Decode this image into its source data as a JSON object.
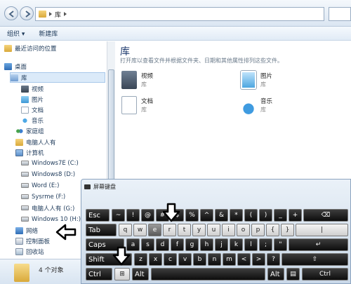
{
  "address": {
    "path": "库"
  },
  "toolbar": {
    "organize": "组织 ▾",
    "new_library": "新建库"
  },
  "nav": {
    "recent": "最近访问的位置",
    "desktop": "桌面",
    "library": "库",
    "video": "视频",
    "pictures": "图片",
    "documents": "文档",
    "music": "音乐",
    "homegroup": "家庭组",
    "user": "电脑人人有",
    "computer": "计算机",
    "drives": [
      "Windows7E (C:)",
      "Windows8 (D:)",
      "Word (E:)",
      "Sysrme (F:)",
      "电脑人人有 (G:)",
      "Windows 10 (H:)"
    ],
    "network": "网络",
    "control_panel": "控制面板",
    "recycle_bin": "回收站"
  },
  "content": {
    "heading": "库",
    "subtitle": "打开库以查看文件并根据文件夹、日期和其他属性排列这些文件。",
    "items": [
      {
        "name": "视频",
        "sub": "库"
      },
      {
        "name": "图片",
        "sub": "库"
      },
      {
        "name": "文档",
        "sub": "库"
      },
      {
        "name": "音乐",
        "sub": "库"
      }
    ]
  },
  "status": {
    "count": "4 个对象"
  },
  "keyboard": {
    "title": "屏幕键盘",
    "row1": [
      "Esc",
      "~",
      "!",
      "@",
      "#",
      "$",
      "%",
      "^",
      "&",
      "*",
      "(",
      ")",
      "_",
      "+",
      "⌫"
    ],
    "row2": [
      "Tab",
      "q",
      "w",
      "e",
      "r",
      "t",
      "y",
      "u",
      "i",
      "o",
      "p",
      "{",
      "}",
      "|"
    ],
    "row3": [
      "Caps",
      "a",
      "s",
      "d",
      "f",
      "g",
      "h",
      "j",
      "k",
      "l",
      ";",
      "\"",
      "↵"
    ],
    "row4": [
      "Shift",
      "z",
      "x",
      "c",
      "v",
      "b",
      "n",
      "m",
      "<",
      ">",
      "?",
      "⇧"
    ],
    "row5": [
      "Ctrl",
      "⊞",
      "Alt",
      "",
      "Alt",
      "▤",
      "Ctrl"
    ]
  },
  "colors": {
    "accent": "#1e3a6e",
    "selection": "#dbeaf9",
    "key_dark": "#111111",
    "pointer": "#000000"
  },
  "icons": [
    "back-arrow-icon",
    "forward-arrow-icon",
    "folder-icon",
    "pointer-arrow-icon"
  ]
}
